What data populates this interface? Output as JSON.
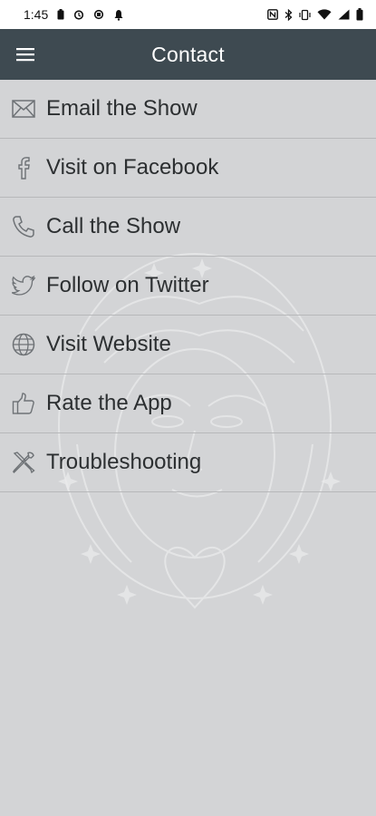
{
  "status_bar": {
    "time": "1:45",
    "icons": [
      "battery-saver-icon",
      "alarm-icon",
      "sync-icon",
      "clock-icon",
      "notification-icon",
      "nfc-icon",
      "bluetooth-icon",
      "vibrate-icon",
      "wifi-icon",
      "signal-icon",
      "battery-icon"
    ]
  },
  "app_bar": {
    "title": "Contact",
    "menu_icon": "hamburger-menu-icon"
  },
  "contact_items": [
    {
      "label": "Email the Show",
      "icon": "envelope-icon"
    },
    {
      "label": "Visit on Facebook",
      "icon": "facebook-icon"
    },
    {
      "label": "Call the Show",
      "icon": "phone-icon"
    },
    {
      "label": "Follow on Twitter",
      "icon": "twitter-icon"
    },
    {
      "label": "Visit Website",
      "icon": "globe-icon"
    },
    {
      "label": "Rate the App",
      "icon": "thumbs-up-icon"
    },
    {
      "label": "Troubleshooting",
      "icon": "tools-icon"
    }
  ],
  "colors": {
    "app_bar": "#3e4a51",
    "background": "#d3d4d6",
    "divider": "#b7b8ba",
    "text": "#2c2f31",
    "icon": "#6e7276"
  }
}
